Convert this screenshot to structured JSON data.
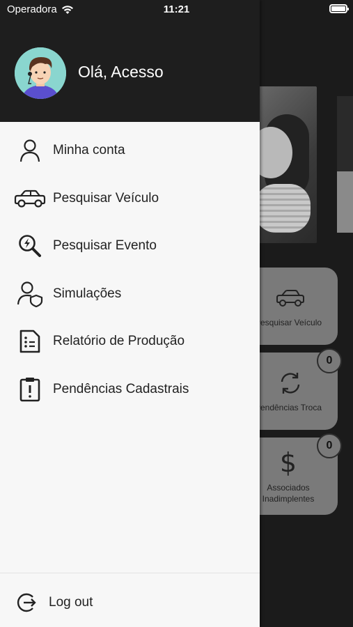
{
  "status_bar": {
    "carrier": "Operadora",
    "time": "11:21"
  },
  "drawer": {
    "greeting": "Olá, Acesso",
    "menu": [
      {
        "label": "Minha conta",
        "icon": "user-icon"
      },
      {
        "label": "Pesquisar Veículo",
        "icon": "car-icon"
      },
      {
        "label": "Pesquisar Evento",
        "icon": "search-event-icon"
      },
      {
        "label": "Simulações",
        "icon": "user-shield-icon"
      },
      {
        "label": "Relatório de Produção",
        "icon": "report-icon"
      },
      {
        "label": "Pendências Cadastrais",
        "icon": "clipboard-alert-icon"
      }
    ],
    "logout_label": "Log out"
  },
  "background": {
    "tiles": [
      {
        "label": "Pesquisar Veículo",
        "icon": "car-icon"
      },
      {
        "label": "Pendências Troca",
        "icon": "refresh-icon",
        "badge": "0"
      },
      {
        "label": "Associados Inadimplentes",
        "icon": "dollar-icon",
        "badge": "0"
      }
    ]
  }
}
